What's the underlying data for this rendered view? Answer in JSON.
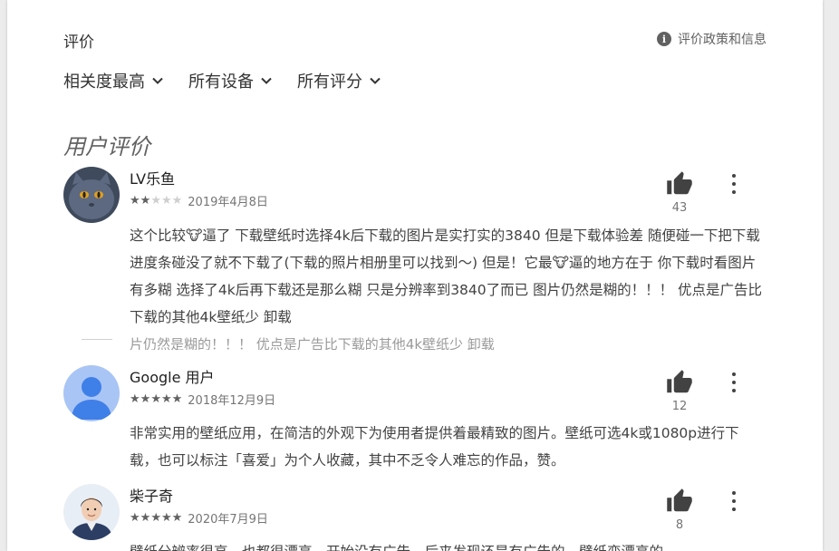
{
  "header": {
    "title": "评价",
    "policy_link": "评价政策和信息",
    "policy_icon": "info-icon"
  },
  "filters": [
    {
      "label": "相关度最高"
    },
    {
      "label": "所有设备"
    },
    {
      "label": "所有评分"
    }
  ],
  "section_title": "用户评价",
  "reviews": [
    {
      "name": "LV乐鱼",
      "rating": 2,
      "date": "2019年4月8日",
      "helpful_count": "43",
      "text": "这个比较🐮逼了 下载壁纸时选择4k后下载的图片是实打实的3840 但是下载体验差 随便碰一下把下载进度条碰没了就不下载了(下载的照片相册里可以找到～) 但是！它最🐮逼的地方在于 你下载时看图片有多糊 选择了4k后再下载还是那么糊 只是分辨率到3840了而已 图片仍然是糊的！！！ 优点是广告比下载的其他4k壁纸少 卸载",
      "avatar": "cat-avatar"
    },
    {
      "name": "Google 用户",
      "rating": 5,
      "date": "2018年12月9日",
      "helpful_count": "12",
      "text": "非常实用的壁纸应用，在简洁的外观下为使用者提供着最精致的图片。壁纸可选4k或1080p进行下载，也可以标注「喜爱」为个人收藏，其中不乏令人难忘的作品，赞。",
      "avatar": "default-user-avatar"
    },
    {
      "name": "柴子奇",
      "rating": 5,
      "date": "2020年7月9日",
      "helpful_count": "8",
      "text": "壁纸分辨率很高，也都很漂亮，开始没有广告，后来发现还是有广告的，壁纸变漂亮的",
      "avatar": "person-avatar"
    }
  ],
  "ghost_text": "片仍然是糊的！！！ 优点是广告比下载的其他4k壁纸少 卸载",
  "colors": {
    "background": "#ececec",
    "card": "#ffffff",
    "text_primary": "#212121",
    "text_secondary": "#757575",
    "user_avatar_bg": "#a9c5f5",
    "user_avatar_fg": "#3f7fe8"
  }
}
